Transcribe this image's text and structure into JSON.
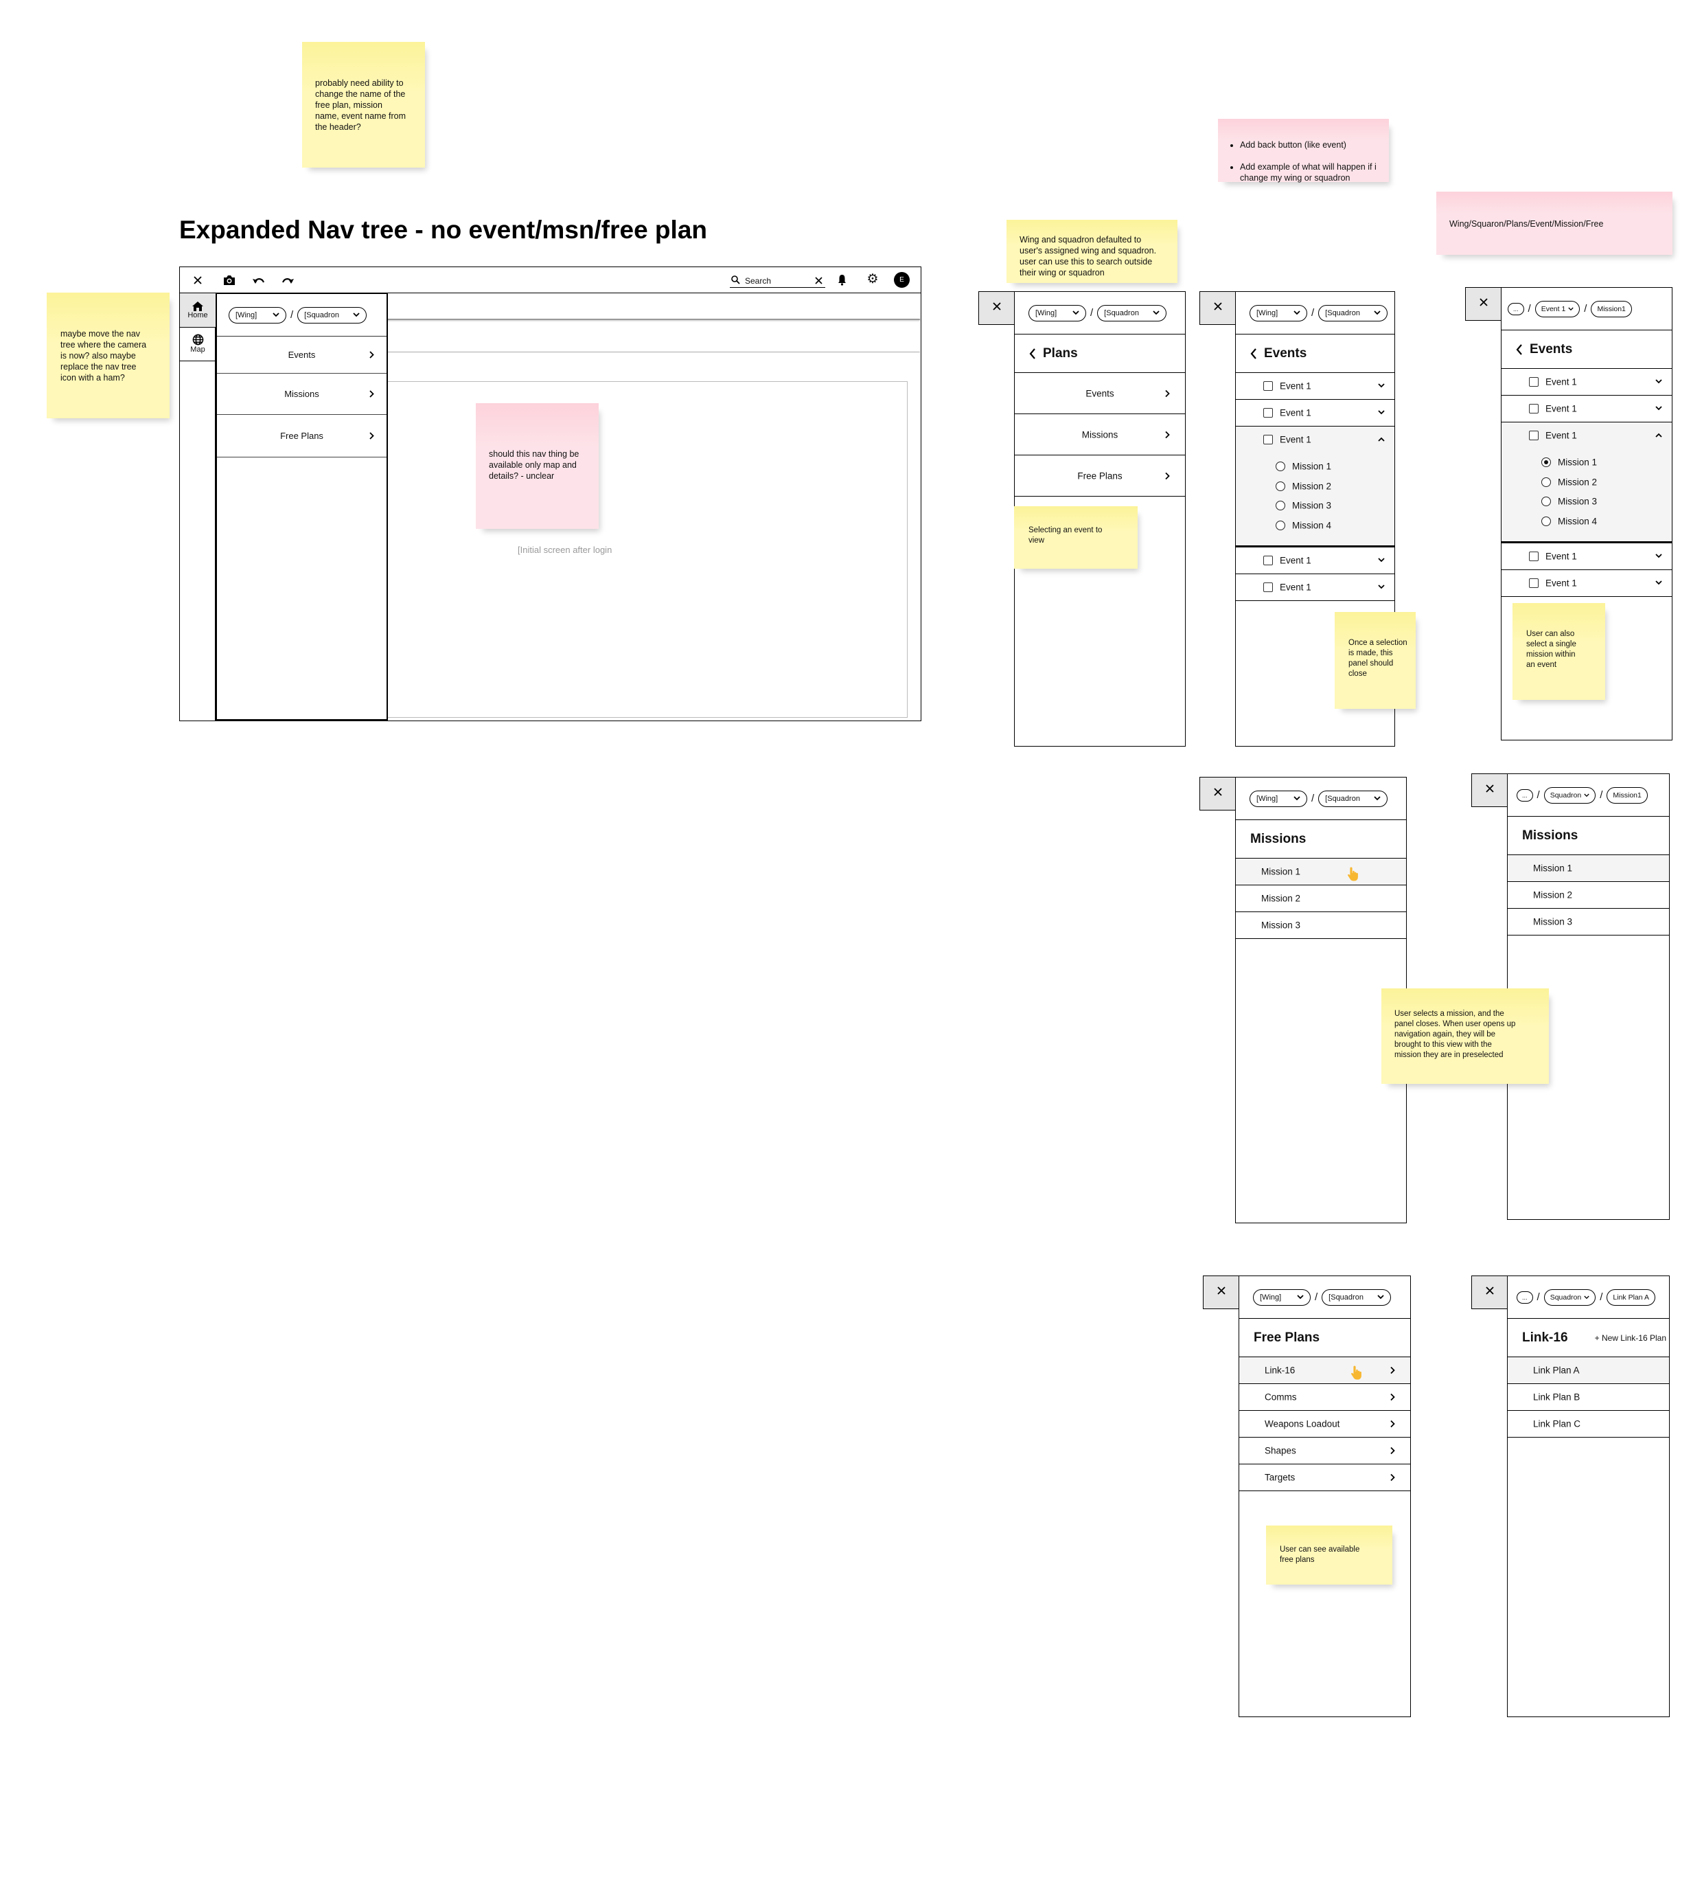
{
  "title": "Expanded Nav tree - no event/msn/free plan",
  "notes": {
    "rename_header": "probably need ability to\nchange the name of the\nfree plan, mission\nname, event name from\nthe header?",
    "move_nav_tree": "maybe move the nav\ntree where the camera\nis now? also maybe\nreplace the nav tree\nicon with a ham?",
    "nav_availability": "should this nav thing be\navailable only map and\ndetails?  - unclear",
    "back_button": [
      "Add back button (like event)",
      "Add example of what will happen if i change my wing or squadron"
    ],
    "hierarchy": "Wing/Squaron/Plans/Event/Mission/Free",
    "wing_default": "Wing and squadron defaulted to\nuser's assigned wing and squadron.\nuser can use this to search outside\ntheir wing or squadron",
    "selecting_event": "Selecting an event to\nview",
    "selection_closes": "Once a selection\nis made, this\npanel should\nclose",
    "single_mission": "User can also\nselect a single\nmission within\nan event",
    "mission_preselected": "User selects a mission, and the\npanel closes. When user opens up\nnavigation again, they will be\nbrought to this view with the\nmission they are in preselected",
    "free_plans": "User can see available\nfree plans"
  },
  "main": {
    "toolbar": {
      "search_placeholder": "Search",
      "avatar_initial": "E"
    },
    "rail": [
      {
        "label": "Home",
        "icon": "home-icon",
        "active": true
      },
      {
        "label": "Map",
        "icon": "globe-icon",
        "active": false
      }
    ],
    "breadcrumb": {
      "wing": "[Wing]",
      "separator": "/",
      "squadron": "[Squadron"
    },
    "nav_items": [
      "Events",
      "Missions",
      "Free Plans"
    ],
    "caption": "[Initial screen after login"
  },
  "panels": [
    {
      "id": "plans",
      "breadcrumb": [
        {
          "text": "[Wing]",
          "chevron": true
        },
        {
          "text": "[Squadron",
          "chevron": true
        }
      ],
      "header": {
        "title": "Plans",
        "back": true
      },
      "rows": [
        {
          "type": "nav",
          "label": "Events"
        },
        {
          "type": "nav",
          "label": "Missions"
        },
        {
          "type": "nav",
          "label": "Free Plans"
        }
      ]
    },
    {
      "id": "events",
      "breadcrumb": [
        {
          "text": "[Wing]",
          "chevron": true
        },
        {
          "text": "[Squadron",
          "chevron": true
        }
      ],
      "header": {
        "title": "Events",
        "back": true
      },
      "rows": [
        {
          "type": "event",
          "label": "Event 1"
        },
        {
          "type": "event",
          "label": "Event 1"
        },
        {
          "type": "event",
          "label": "Event 1",
          "expanded": true,
          "missions": [
            {
              "label": "Mission 1",
              "selected": false
            },
            {
              "label": "Mission 2",
              "selected": false
            },
            {
              "label": "Mission 3",
              "selected": false
            },
            {
              "label": "Mission 4",
              "selected": false
            }
          ]
        },
        {
          "type": "event",
          "label": "Event 1"
        },
        {
          "type": "event",
          "label": "Event 1"
        }
      ]
    },
    {
      "id": "events-mission-selected",
      "breadcrumb": [
        {
          "text": "...",
          "chevron": false,
          "small": true
        },
        {
          "text": "Event 1",
          "chevron": true
        },
        {
          "text": "Mission1",
          "chevron": false
        }
      ],
      "header": {
        "title": "Events",
        "back": true
      },
      "rows": [
        {
          "type": "event",
          "label": "Event 1"
        },
        {
          "type": "event",
          "label": "Event 1"
        },
        {
          "type": "event",
          "label": "Event 1",
          "expanded": true,
          "missions": [
            {
              "label": "Mission 1",
              "selected": true
            },
            {
              "label": "Mission 2",
              "selected": false
            },
            {
              "label": "Mission 3",
              "selected": false
            },
            {
              "label": "Mission 4",
              "selected": false
            }
          ]
        },
        {
          "type": "event",
          "label": "Event 1"
        },
        {
          "type": "event",
          "label": "Event 1"
        }
      ]
    },
    {
      "id": "missions",
      "breadcrumb": [
        {
          "text": "[Wing]",
          "chevron": true
        },
        {
          "text": "[Squadron",
          "chevron": true
        }
      ],
      "header": {
        "title": "Missions",
        "back": false
      },
      "rows": [
        {
          "type": "item",
          "label": "Mission 1",
          "highlighted": true,
          "cursor": true
        },
        {
          "type": "item",
          "label": "Mission 2"
        },
        {
          "type": "item",
          "label": "Mission 3"
        }
      ]
    },
    {
      "id": "missions-preselected",
      "breadcrumb": [
        {
          "text": "...",
          "chevron": false,
          "small": true
        },
        {
          "text": "Squadron",
          "chevron": true
        },
        {
          "text": "Mission1",
          "chevron": false
        }
      ],
      "header": {
        "title": "Missions",
        "back": false
      },
      "rows": [
        {
          "type": "item",
          "label": "Mission 1",
          "highlighted": true
        },
        {
          "type": "item",
          "label": "Mission 2"
        },
        {
          "type": "item",
          "label": "Mission 3"
        }
      ]
    },
    {
      "id": "free-plans",
      "breadcrumb": [
        {
          "text": "[Wing]",
          "chevron": true
        },
        {
          "text": "[Squadron",
          "chevron": true
        }
      ],
      "header": {
        "title": "Free Plans",
        "back": false
      },
      "rows": [
        {
          "type": "item",
          "label": "Link-16",
          "highlighted": true,
          "cursor": true,
          "chevron": true
        },
        {
          "type": "item",
          "label": "Comms",
          "chevron": true
        },
        {
          "type": "item",
          "label": "Weapons Loadout",
          "chevron": true
        },
        {
          "type": "item",
          "label": "Shapes",
          "chevron": true
        },
        {
          "type": "item",
          "label": "Targets",
          "chevron": true
        }
      ]
    },
    {
      "id": "link16",
      "breadcrumb": [
        {
          "text": "...",
          "chevron": false,
          "small": true
        },
        {
          "text": "Squadron",
          "chevron": true
        },
        {
          "text": "Link Plan A",
          "chevron": false
        }
      ],
      "header": {
        "title": "Link-16",
        "back": false,
        "action": "+ New Link-16 Plan"
      },
      "rows": [
        {
          "type": "item",
          "label": "Link Plan A",
          "highlighted": true
        },
        {
          "type": "item",
          "label": "Link Plan B"
        },
        {
          "type": "item",
          "label": "Link Plan C"
        }
      ]
    }
  ],
  "colors": {
    "sticky_yellow": "#fff6b0",
    "sticky_pink": "#fde0e7",
    "highlight_row": "#f4f4f4",
    "rail_active": "#e6e6e6",
    "cursor": "#f7b731"
  }
}
